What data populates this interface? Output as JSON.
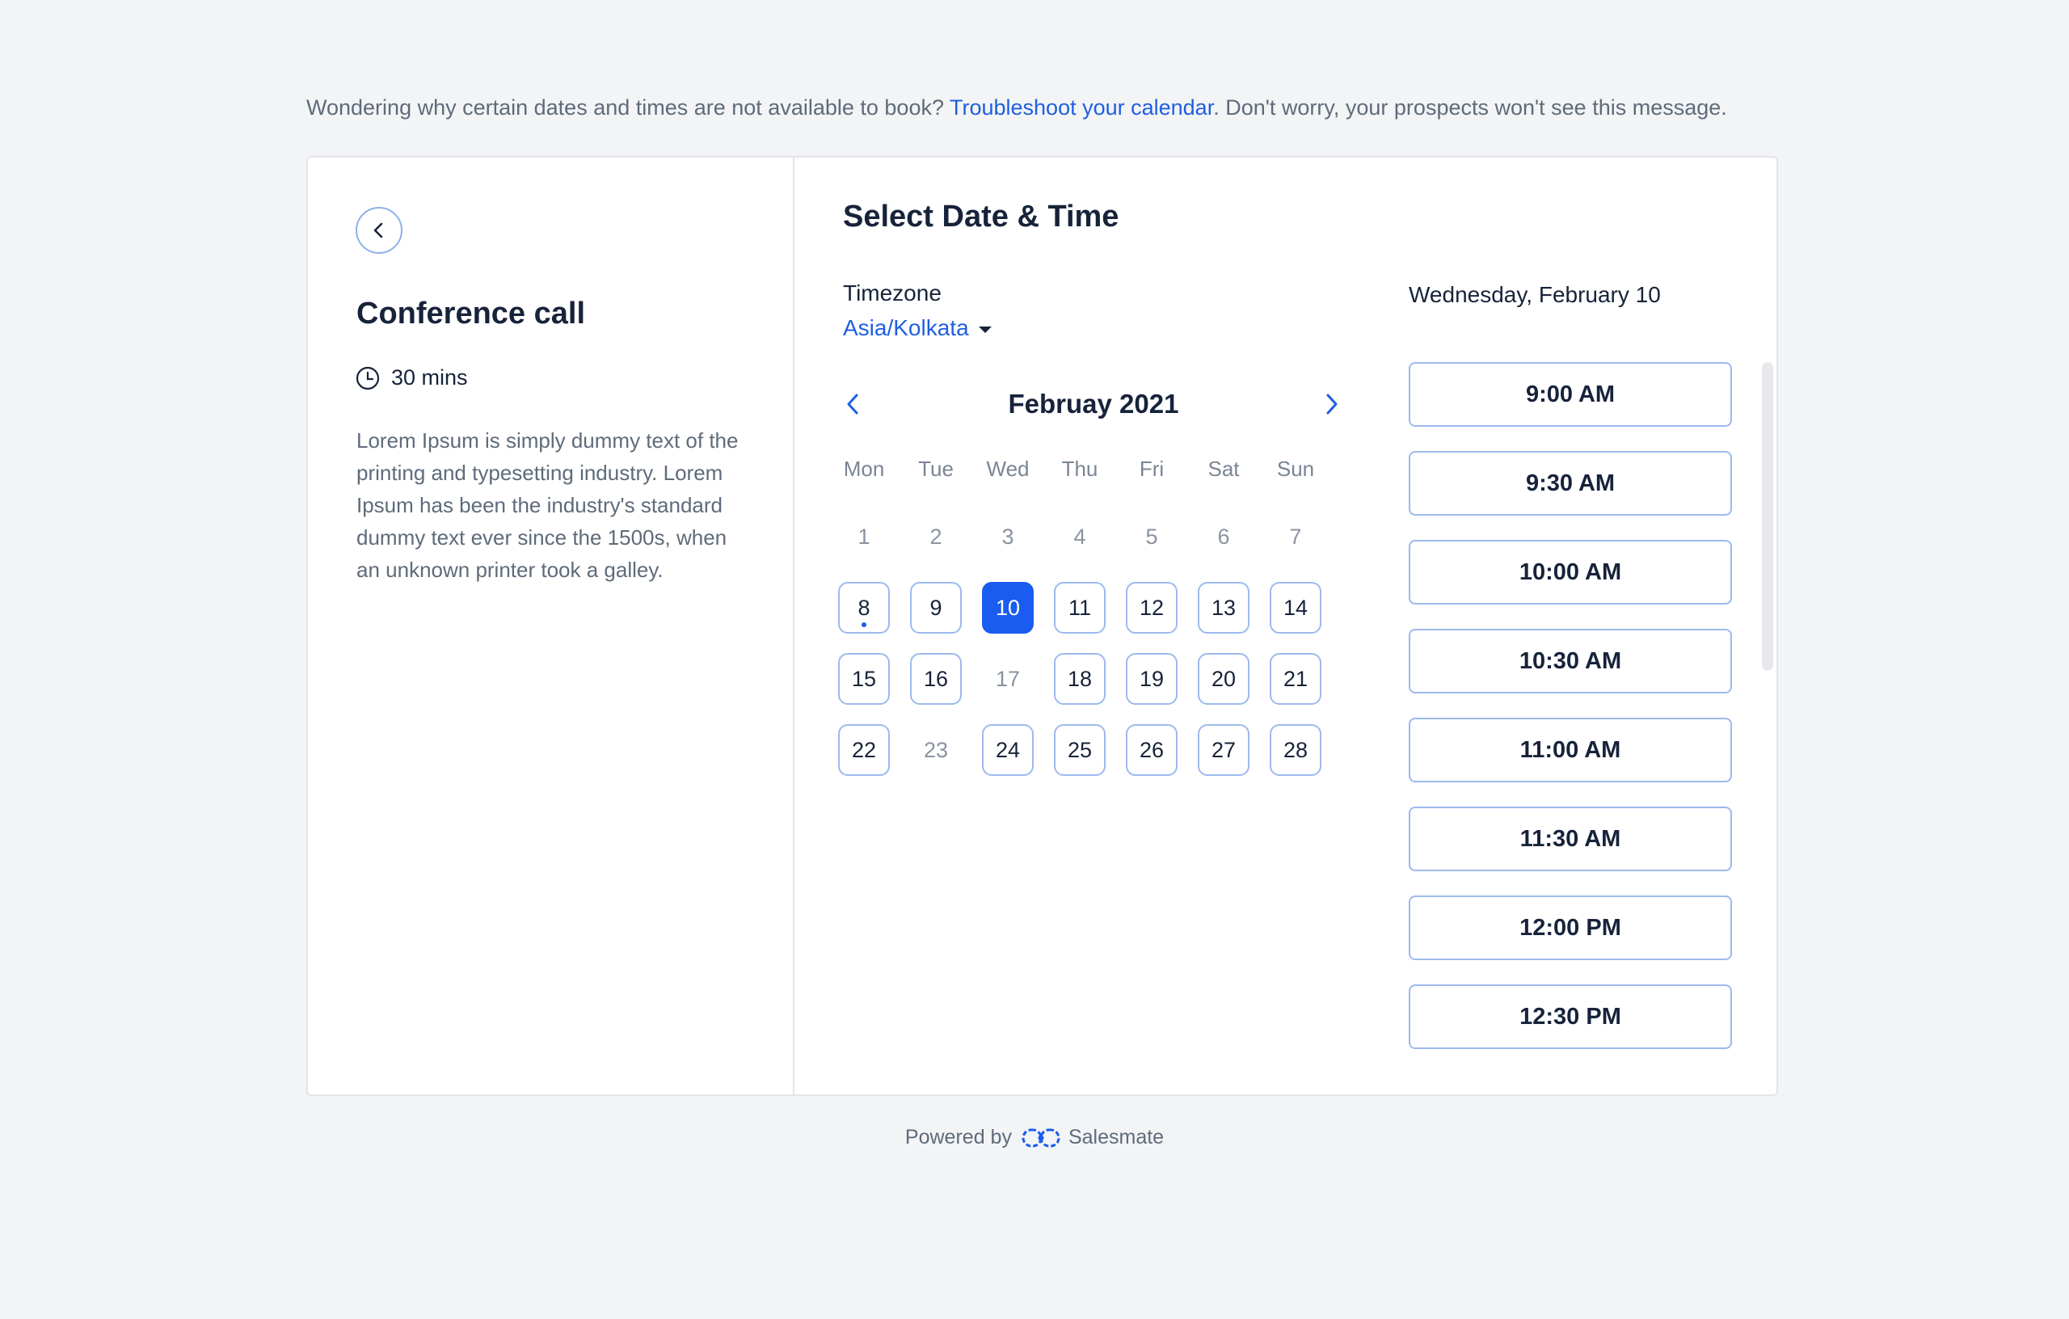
{
  "notice": {
    "before": "Wondering why certain dates and times are not available to book? ",
    "link": "Troubleshoot your calendar",
    "after": ". Don't worry, your prospects won't see this message."
  },
  "event": {
    "title": "Conference call",
    "duration": "30 mins",
    "description": "Lorem Ipsum is simply dummy text of the printing and typesetting industry. Lorem Ipsum has been the industry's standard dummy text ever since the 1500s, when an unknown printer took a galley."
  },
  "scheduler": {
    "heading": "Select Date & Time",
    "timezone_label": "Timezone",
    "timezone_value": "Asia/Kolkata",
    "month": "Februay 2021",
    "weekdays": [
      "Mon",
      "Tue",
      "Wed",
      "Thu",
      "Fri",
      "Sat",
      "Sun"
    ],
    "days": [
      {
        "n": "1",
        "state": "disabled"
      },
      {
        "n": "2",
        "state": "disabled"
      },
      {
        "n": "3",
        "state": "disabled"
      },
      {
        "n": "4",
        "state": "disabled"
      },
      {
        "n": "5",
        "state": "disabled"
      },
      {
        "n": "6",
        "state": "disabled"
      },
      {
        "n": "7",
        "state": "disabled"
      },
      {
        "n": "8",
        "state": "available",
        "today": true
      },
      {
        "n": "9",
        "state": "available"
      },
      {
        "n": "10",
        "state": "selected"
      },
      {
        "n": "11",
        "state": "available"
      },
      {
        "n": "12",
        "state": "available"
      },
      {
        "n": "13",
        "state": "available"
      },
      {
        "n": "14",
        "state": "available"
      },
      {
        "n": "15",
        "state": "available"
      },
      {
        "n": "16",
        "state": "available"
      },
      {
        "n": "17",
        "state": "disabled"
      },
      {
        "n": "18",
        "state": "available"
      },
      {
        "n": "19",
        "state": "available"
      },
      {
        "n": "20",
        "state": "available"
      },
      {
        "n": "21",
        "state": "available"
      },
      {
        "n": "22",
        "state": "available"
      },
      {
        "n": "23",
        "state": "disabled"
      },
      {
        "n": "24",
        "state": "available"
      },
      {
        "n": "25",
        "state": "available"
      },
      {
        "n": "26",
        "state": "available"
      },
      {
        "n": "27",
        "state": "available"
      },
      {
        "n": "28",
        "state": "available"
      }
    ],
    "selected_date": "Wednesday, February 10",
    "time_slots": [
      "9:00 AM",
      "9:30 AM",
      "10:00 AM",
      "10:30 AM",
      "11:00 AM",
      "11:30 AM",
      "12:00 PM",
      "12:30 PM"
    ]
  },
  "footer": {
    "powered_by": "Powered by",
    "brand": "Salesmate"
  },
  "colors": {
    "accent": "#1a5cf0",
    "border_available": "#9db9ee",
    "background": "#f3f4f6"
  }
}
